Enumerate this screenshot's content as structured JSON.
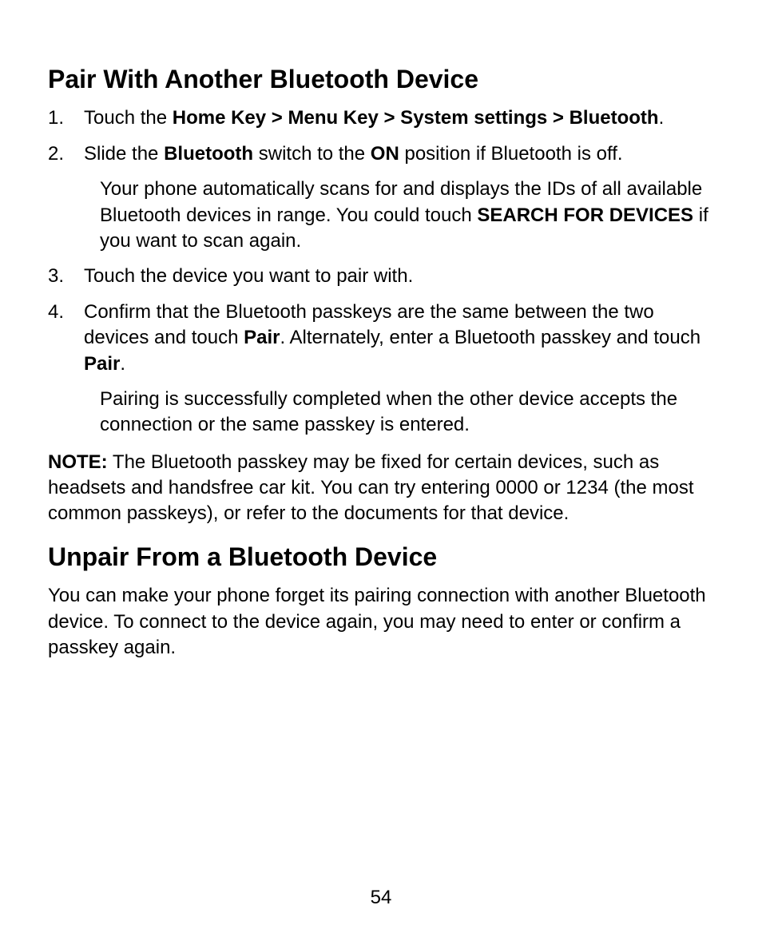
{
  "section1": {
    "heading": "Pair With Another Bluetooth Device",
    "steps": [
      {
        "marker": "1.",
        "segments": [
          {
            "t": "Touch the ",
            "b": false
          },
          {
            "t": "Home Key > Menu Key > System settings > Bluetooth",
            "b": true
          },
          {
            "t": ".",
            "b": false
          }
        ]
      },
      {
        "marker": "2.",
        "segments": [
          {
            "t": "Slide the ",
            "b": false
          },
          {
            "t": "Bluetooth",
            "b": true
          },
          {
            "t": " switch to the ",
            "b": false
          },
          {
            "t": "ON",
            "b": true
          },
          {
            "t": " position if Bluetooth is off.",
            "b": false
          }
        ],
        "sub": [
          {
            "t": "Your phone automatically scans for and displays the IDs of all available Bluetooth devices in range. You could touch ",
            "b": false
          },
          {
            "t": "SEARCH FOR DEVICES",
            "b": true
          },
          {
            "t": " if you want to scan again.",
            "b": false
          }
        ]
      },
      {
        "marker": "3.",
        "segments": [
          {
            "t": "Touch the device you want to pair with.",
            "b": false
          }
        ]
      },
      {
        "marker": "4.",
        "segments": [
          {
            "t": "Confirm that the Bluetooth passkeys are the same between the two devices and touch ",
            "b": false
          },
          {
            "t": "Pair",
            "b": true
          },
          {
            "t": ". Alternately, enter a Bluetooth passkey and touch ",
            "b": false
          },
          {
            "t": "Pair",
            "b": true
          },
          {
            "t": ".",
            "b": false
          }
        ],
        "sub": [
          {
            "t": "Pairing is successfully completed when the other device accepts the connection or the same passkey is entered.",
            "b": false
          }
        ]
      }
    ],
    "note_segments": [
      {
        "t": "NOTE:",
        "b": true
      },
      {
        "t": " The Bluetooth passkey may be fixed for certain devices, such as headsets and handsfree car kit. You can try entering 0000 or 1234 (the most common passkeys), or refer to the documents for that device.",
        "b": false
      }
    ]
  },
  "section2": {
    "heading": "Unpair From a Bluetooth Device",
    "intro": "You can make your phone forget its pairing connection with another Bluetooth device. To connect to the device again, you may need to enter or confirm a passkey again."
  },
  "page_number": "54"
}
